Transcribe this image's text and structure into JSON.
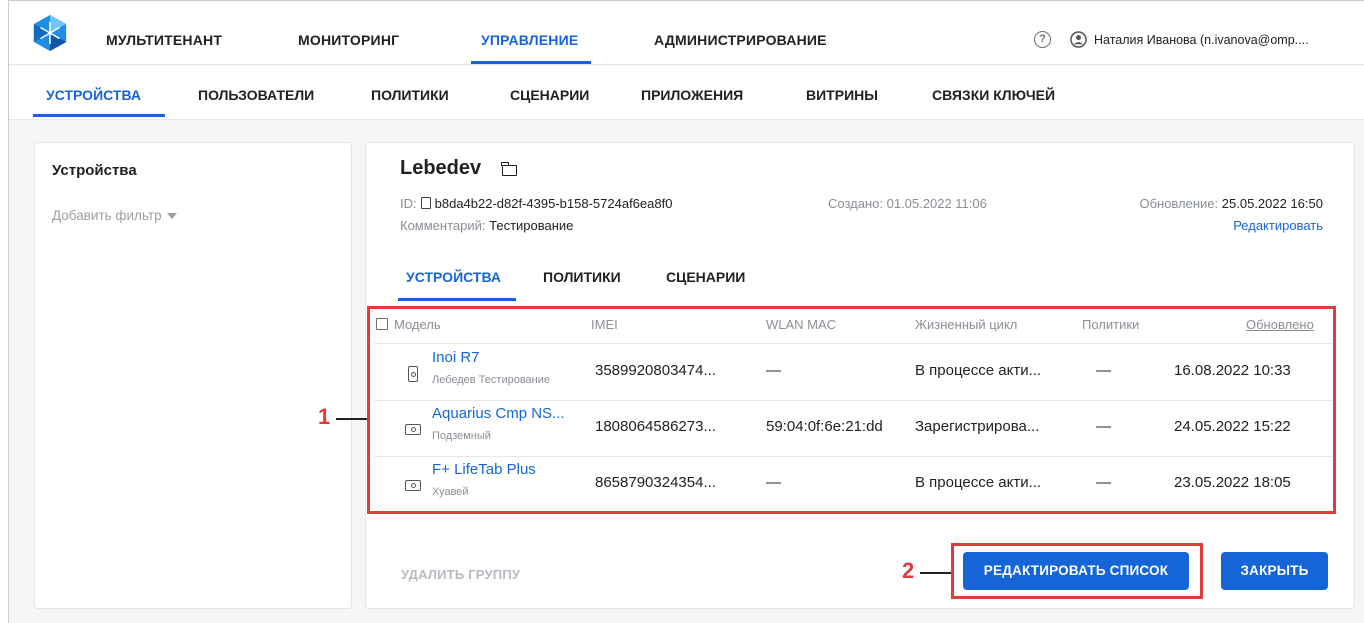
{
  "topnav": {
    "items": [
      "МУЛЬТИТЕНАНТ",
      "МОНИТОРИНГ",
      "УПРАВЛЕНИЕ",
      "АДМИНИСТРИРОВАНИЕ"
    ],
    "active": "УПРАВЛЕНИЕ",
    "help_symbol": "?",
    "user": "Наталия Иванова (n.ivanova@omp...."
  },
  "subnav": {
    "items": [
      "УСТРОЙСТВА",
      "ПОЛЬЗОВАТЕЛИ",
      "ПОЛИТИКИ",
      "СЦЕНАРИИ",
      "ПРИЛОЖЕНИЯ",
      "ВИТРИНЫ",
      "СВЯЗКИ КЛЮЧЕЙ"
    ],
    "active": "УСТРОЙСТВА"
  },
  "left": {
    "title": "Устройства",
    "add_filter": "Добавить фильтр"
  },
  "group": {
    "name": "Lebedev",
    "id_label": "ID:",
    "id": "b8da4b22-d82f-4395-b158-5724af6ea8f0",
    "comment_label": "Комментарий:",
    "comment": "Тестирование",
    "created_label": "Создано:",
    "created": "01.05.2022 11:06",
    "updated_label": "Обновление:",
    "updated": "25.05.2022 16:50",
    "edit_link": "Редактировать"
  },
  "inner_tabs": [
    "УСТРОЙСТВА",
    "ПОЛИТИКИ",
    "СЦЕНАРИИ"
  ],
  "table": {
    "headers": [
      "Модель",
      "IMEI",
      "WLAN MAC",
      "Жизненный цикл",
      "Политики",
      "Обновлено"
    ],
    "rows": [
      {
        "model": "Inoi R7",
        "owner": "Лебедев Тестирование",
        "imei": "3589920803474...",
        "mac": "—",
        "lifecycle": "В процессе акти...",
        "policies": "—",
        "updated": "16.08.2022 10:33",
        "icon": "phone-icon"
      },
      {
        "model": "Aquarius Cmp NS...",
        "owner": "Подземный",
        "imei": "1808064586273...",
        "mac": "59:04:0f:6e:21:dd",
        "lifecycle": "Зарегистрирова...",
        "policies": "—",
        "updated": "24.05.2022 15:22",
        "icon": "tablet-icon"
      },
      {
        "model": "F+ LifeTab Plus",
        "owner": "Хуавей",
        "imei": "8658790324354...",
        "mac": "—",
        "lifecycle": "В процессе акти...",
        "policies": "—",
        "updated": "23.05.2022 18:05",
        "icon": "tablet-icon"
      }
    ]
  },
  "footer": {
    "delete_group": "УДАЛИТЬ ГРУППУ",
    "edit_list": "РЕДАКТИРОВАТЬ СПИСОК",
    "close": "ЗАКРЫТЬ"
  },
  "annotations": [
    "1",
    "2"
  ],
  "colors": {
    "accent": "#1565d8",
    "annotation": "#e03c3c"
  }
}
